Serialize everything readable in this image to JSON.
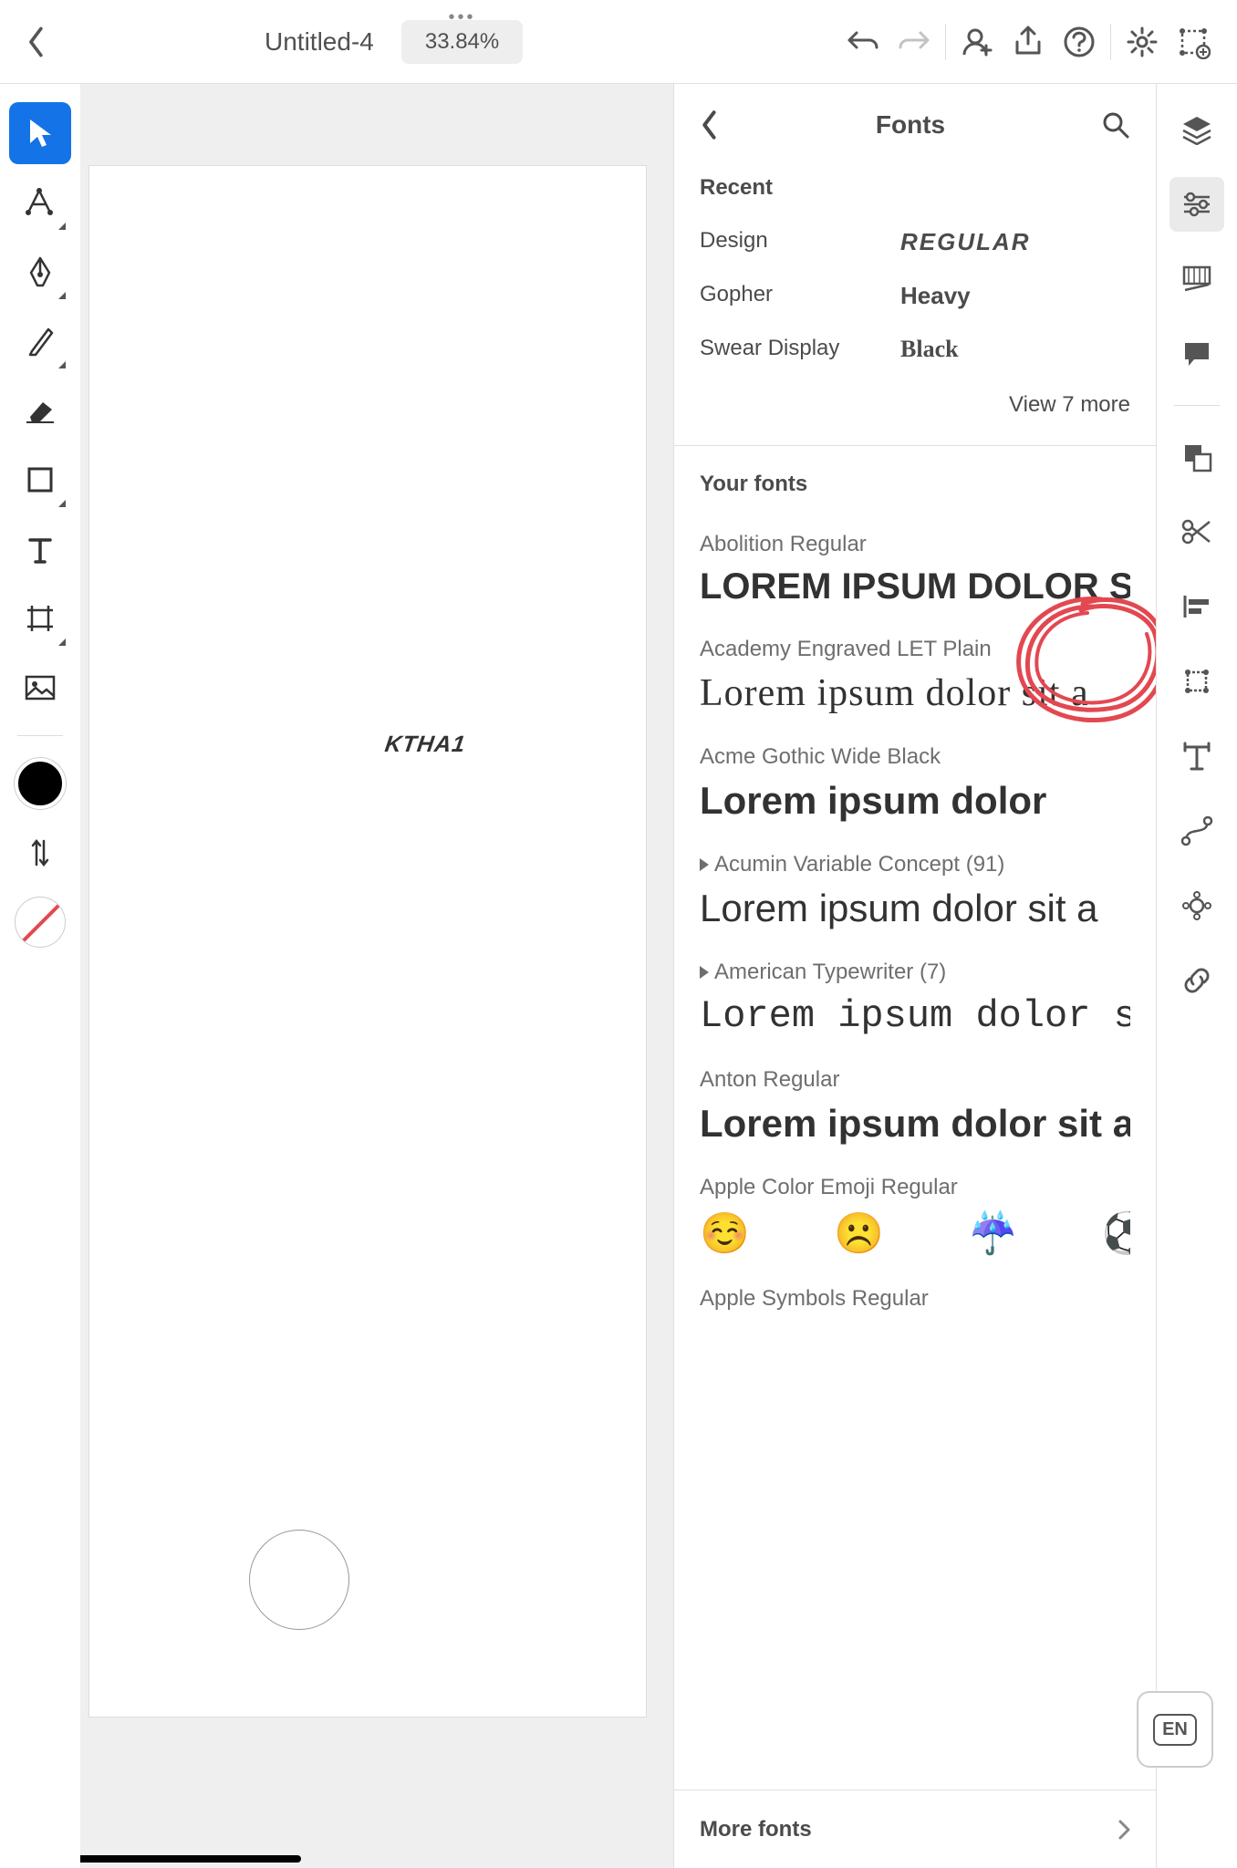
{
  "topbar": {
    "title": "Untitled-4",
    "zoom": "33.84%"
  },
  "canvas": {
    "text": "KTHA1"
  },
  "fonts_panel": {
    "title": "Fonts",
    "recent_label": "Recent",
    "recent": [
      {
        "name": "Design",
        "sample": "Regular",
        "style": "design"
      },
      {
        "name": "Gopher",
        "sample": "Heavy",
        "style": "heavy"
      },
      {
        "name": "Swear Display",
        "sample": "Black",
        "style": "black"
      }
    ],
    "view_more": "View 7 more",
    "your_fonts_label": "Your fonts",
    "fonts": [
      {
        "name": "Abolition Regular",
        "sample": "LOREM IPSUM DOLOR SIT AMET, CONSEC",
        "cls": "fs-abolition",
        "expandable": false
      },
      {
        "name": "Academy Engraved LET Plain",
        "sample": "Lorem ipsum dolor sit a",
        "cls": "fs-academy",
        "expandable": false
      },
      {
        "name": "Acme Gothic Wide Black",
        "sample": "Lorem ipsum dolor",
        "cls": "fs-acme",
        "expandable": false
      },
      {
        "name": "Acumin Variable Concept (91)",
        "sample": "Lorem ipsum dolor sit a",
        "cls": "fs-acumin",
        "expandable": true
      },
      {
        "name": "American Typewriter (7)",
        "sample": "Lorem ipsum dolor s",
        "cls": "fs-american",
        "expandable": true
      },
      {
        "name": "Anton Regular",
        "sample": "Lorem ipsum dolor sit an",
        "cls": "fs-anton",
        "expandable": false
      },
      {
        "name": "Apple Color Emoji Regular",
        "sample": "☺️ ☹️ ☔ ⚽ ♻️",
        "cls": "fs-emoji",
        "expandable": false
      },
      {
        "name": "Apple Symbols Regular",
        "sample": "",
        "cls": "",
        "expandable": false
      }
    ],
    "more_fonts": "More fonts"
  },
  "lang": "EN"
}
